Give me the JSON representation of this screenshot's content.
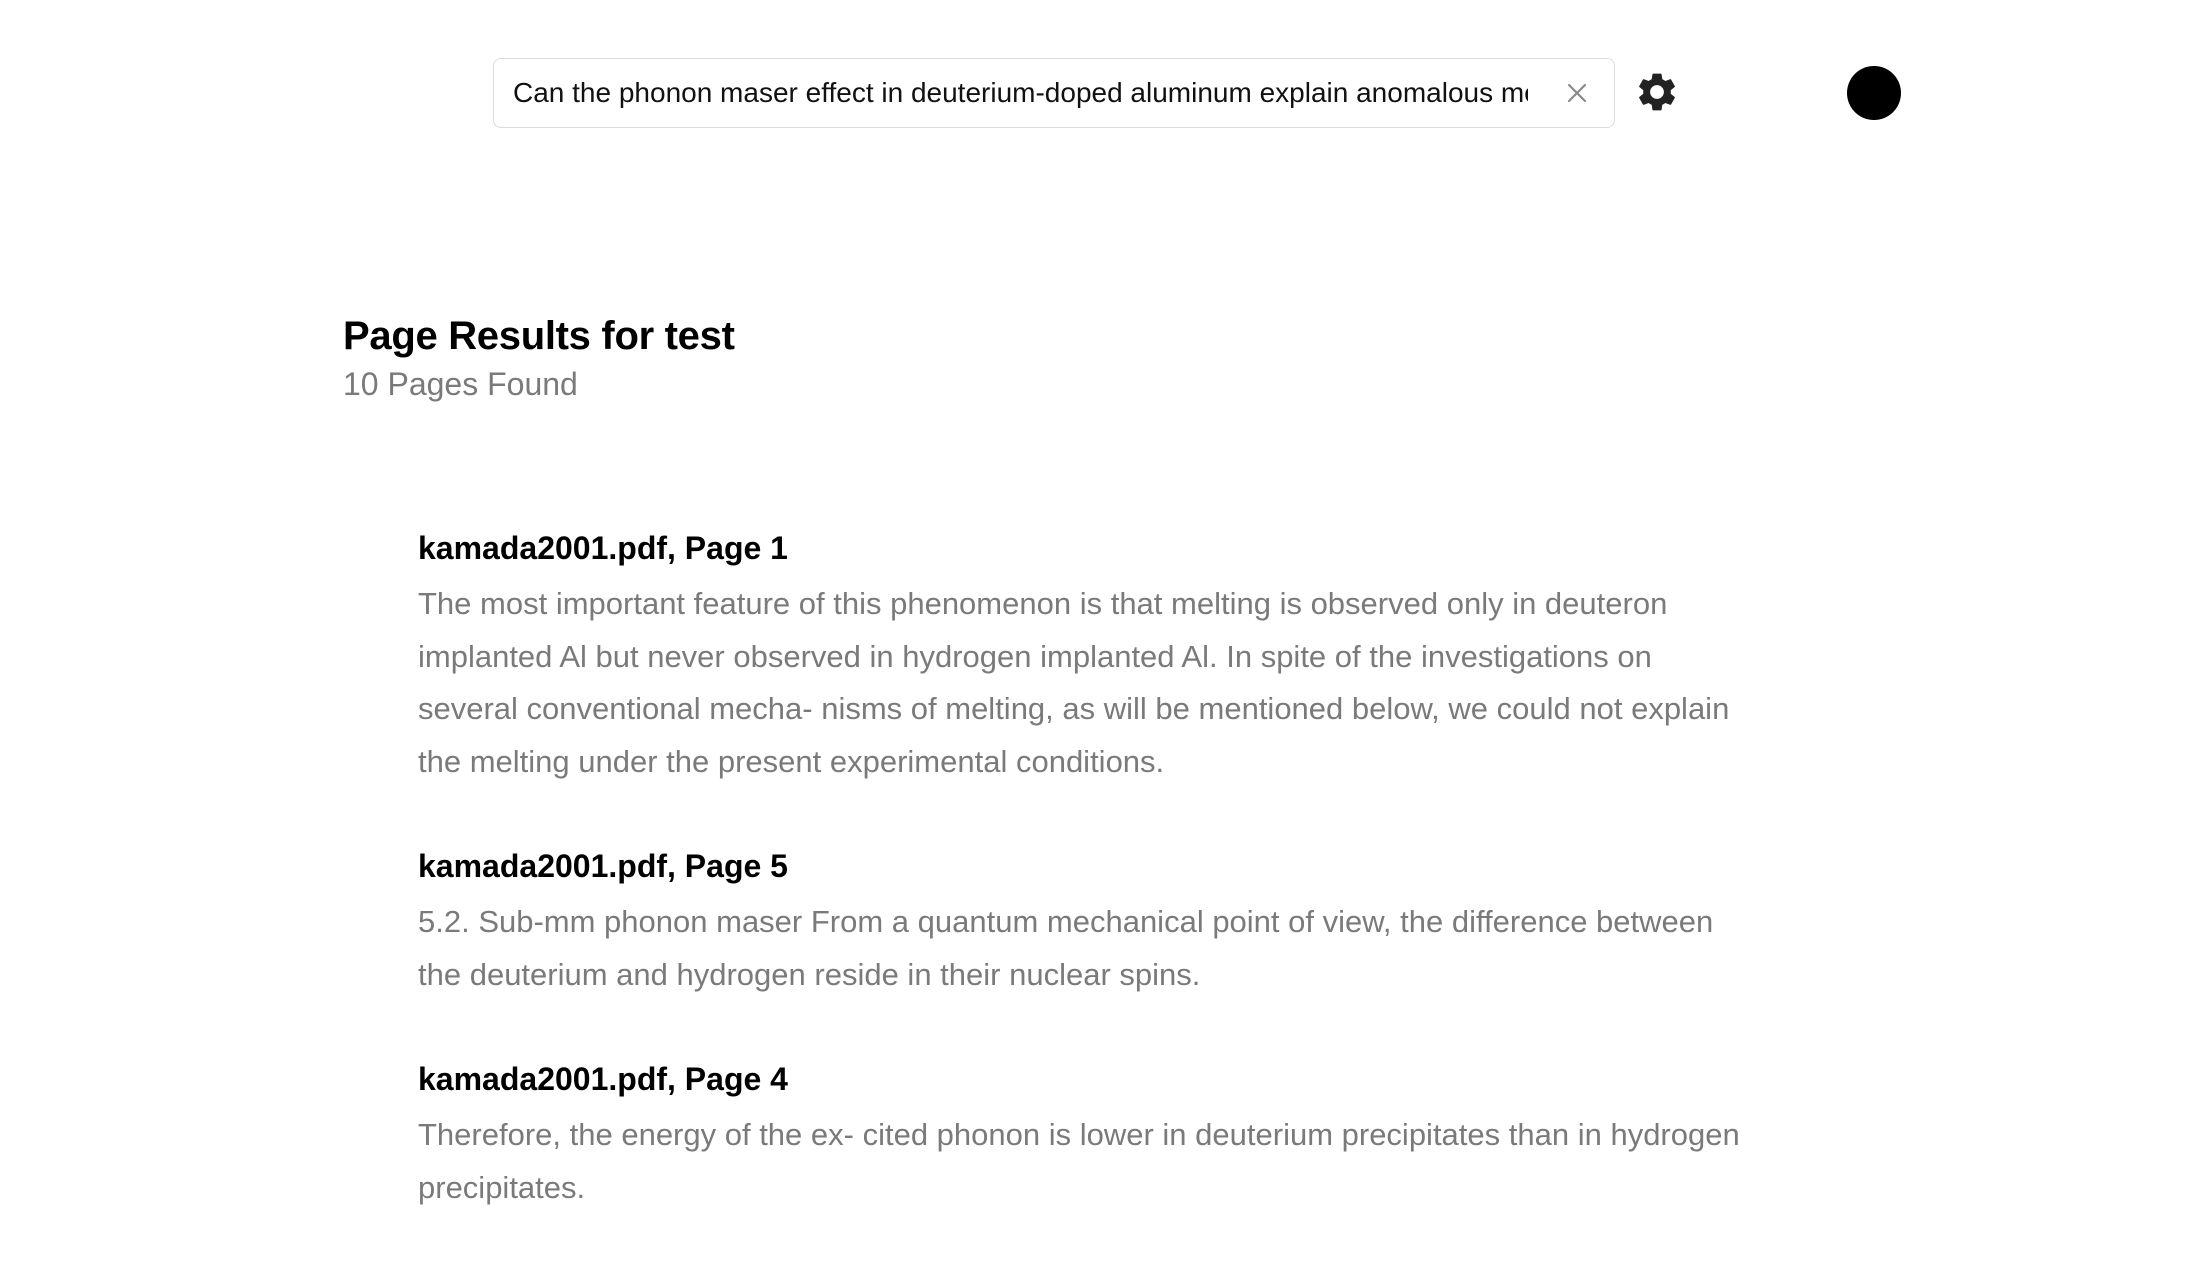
{
  "search": {
    "value": "Can the phonon maser effect in deuterium-doped aluminum explain anomalous melting",
    "clear_icon": "close-icon"
  },
  "settings": {
    "icon": "gear-icon"
  },
  "avatar": {
    "icon": "avatar-circle"
  },
  "results": {
    "title": "Page Results for test",
    "count": "10 Pages Found",
    "items": [
      {
        "title": "kamada2001.pdf, Page 1",
        "snippet": "The most important feature of this phenomenon is that melting is observed only in deuteron implanted Al but never observed in hydrogen implanted Al. In spite of the investigations on several conventional mecha- nisms of melting, as will be mentioned below, we could not explain the melting under the present experimental conditions."
      },
      {
        "title": "kamada2001.pdf, Page 5",
        "snippet": "5.2. Sub-mm phonon maser From a quantum mechanical point of view, the difference between the deuterium and hydrogen reside in their nuclear spins."
      },
      {
        "title": "kamada2001.pdf, Page 4",
        "snippet": "Therefore, the energy of the ex- cited phonon is lower in deuterium precipitates than in hydrogen precipitates."
      }
    ]
  }
}
